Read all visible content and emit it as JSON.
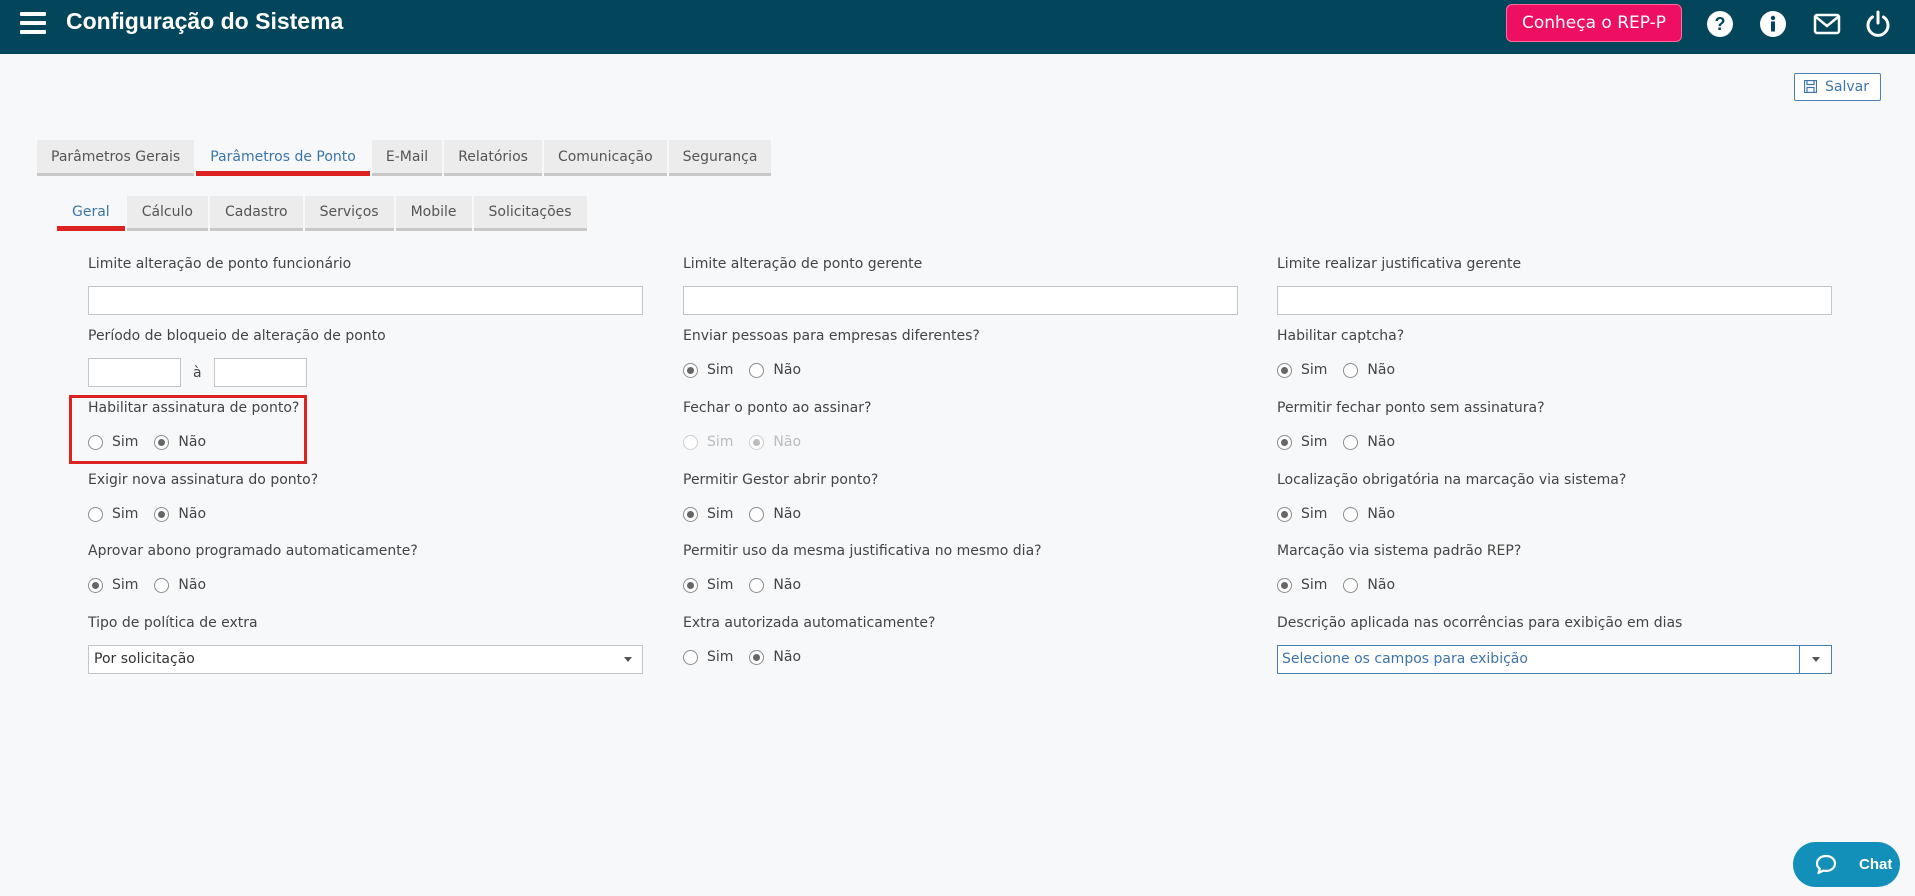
{
  "header": {
    "title": "Configuração do Sistema",
    "rep_button": "Conheça o REP-P"
  },
  "toolbar": {
    "save_label": "Salvar"
  },
  "main_tabs": [
    "Parâmetros Gerais",
    "Parâmetros de Ponto",
    "E-Mail",
    "Relatórios",
    "Comunicação",
    "Segurança"
  ],
  "sub_tabs": [
    "Geral",
    "Cálculo",
    "Cadastro",
    "Serviços",
    "Mobile",
    "Solicitações"
  ],
  "radio": {
    "yes": "Sim",
    "no": "Não"
  },
  "col1": {
    "limit_employee": "Limite alteração de ponto funcionário",
    "block_period": "Período de bloqueio de alteração de ponto",
    "period_sep": "à",
    "enable_signature": "Habilitar assinatura de ponto?",
    "require_new_signature": "Exigir nova assinatura do ponto?",
    "approve_allowance": "Aprovar abono programado automaticamente?",
    "extra_policy": "Tipo de política de extra",
    "extra_policy_value": "Por solicitação"
  },
  "col2": {
    "limit_manager": "Limite alteração de ponto gerente",
    "send_people": "Enviar pessoas para empresas diferentes?",
    "close_on_sign": "Fechar o ponto ao assinar?",
    "manager_open": "Permitir Gestor abrir ponto?",
    "same_justification": "Permitir uso da mesma justificativa no mesmo dia?",
    "extra_auto": "Extra autorizada automaticamente?"
  },
  "col3": {
    "limit_justification": "Limite realizar justificativa gerente",
    "captcha": "Habilitar captcha?",
    "close_without_sign": "Permitir fechar ponto sem assinatura?",
    "location_required": "Localização obrigatória na marcação via sistema?",
    "rep_standard": "Marcação via sistema padrão REP?",
    "description_fields": "Descrição aplicada nas ocorrências para exibição em dias",
    "description_placeholder": "Selecione os campos para exibição"
  },
  "chat": {
    "label": "Chat"
  },
  "colors": {
    "header": "#03455b",
    "accent": "#ef0f62",
    "active_tab": "#dd2222",
    "link": "#3d74a8"
  }
}
